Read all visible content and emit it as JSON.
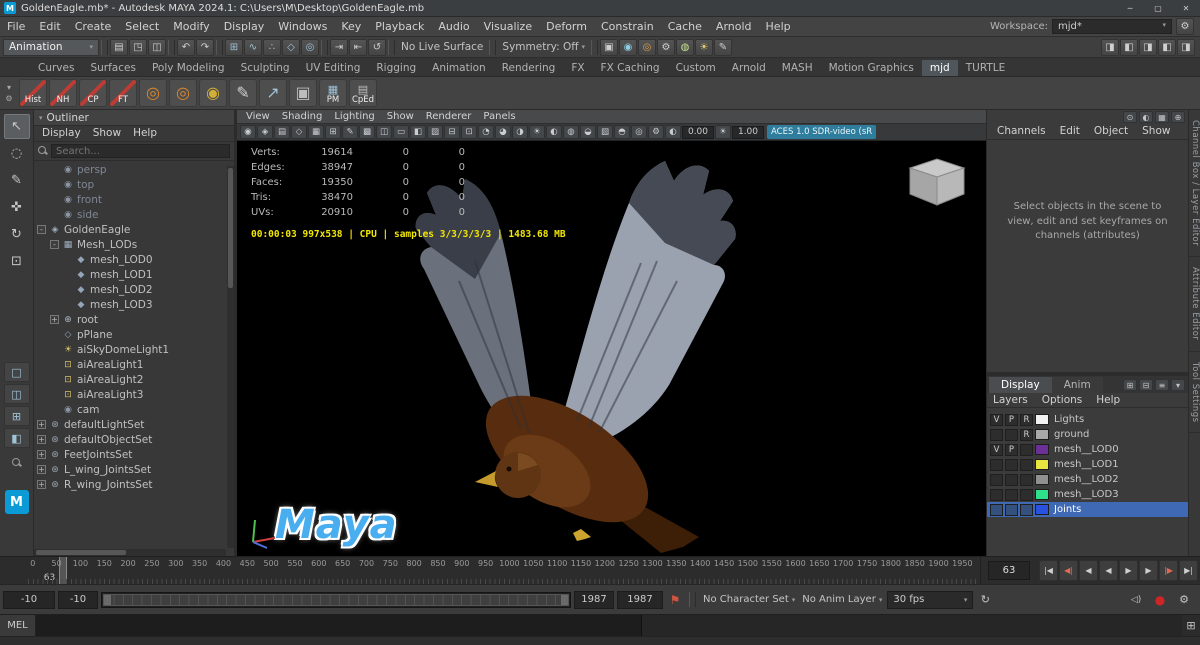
{
  "titlebar": {
    "title": "GoldenEagle.mb* - Autodesk MAYA 2024.1: C:\\Users\\M\\Desktop\\GoldenEagle.mb",
    "window_controls": [
      {
        "name": "minimize-button",
        "glyph": "─"
      },
      {
        "name": "maximize-button",
        "glyph": "▢"
      },
      {
        "name": "close-button",
        "glyph": "✕"
      }
    ]
  },
  "menubar": {
    "items": [
      "File",
      "Edit",
      "Create",
      "Select",
      "Modify",
      "Display",
      "Windows",
      "Key",
      "Playback",
      "Audio",
      "Visualize",
      "Deform",
      "Constrain",
      "Cache",
      "Arnold",
      "Help"
    ],
    "workspace_label": "Workspace:",
    "workspace_value": "mjd*"
  },
  "statusline": {
    "mode_selector": "Animation",
    "groups": [
      {
        "name": "file",
        "icons": [
          {
            "n": "new-scene-icon",
            "g": "▤"
          },
          {
            "n": "open-scene-icon",
            "g": "◳"
          },
          {
            "n": "save-scene-icon",
            "g": "◫"
          }
        ]
      },
      {
        "name": "undo",
        "icons": [
          {
            "n": "undo-icon",
            "g": "↶"
          },
          {
            "n": "redo-icon",
            "g": "↷"
          }
        ]
      },
      {
        "name": "snap",
        "icons": [
          {
            "n": "snap-grid-icon",
            "g": "⊞",
            "c": "#9fc3d8"
          },
          {
            "n": "snap-curve-icon",
            "g": "∿",
            "c": "#9fc3d8"
          },
          {
            "n": "snap-point-icon",
            "g": "∴",
            "c": "#9fc3d8"
          },
          {
            "n": "snap-plane-icon",
            "g": "◇",
            "c": "#9fc3d8"
          },
          {
            "n": "snap-center-icon",
            "g": "◎",
            "c": "#9fc3d8"
          }
        ]
      },
      {
        "name": "history",
        "icons": [
          {
            "n": "input-connections-icon",
            "g": "⇥"
          },
          {
            "n": "output-connections-icon",
            "g": "⇤"
          },
          {
            "n": "construction-history-icon",
            "g": "↺"
          }
        ]
      }
    ],
    "no_live_surface": "No Live Surface",
    "symmetry": "Symmetry: Off",
    "center_icons": [
      {
        "n": "render-view-icon",
        "g": "▣"
      },
      {
        "n": "render-current-frame-icon",
        "g": "◉",
        "c": "#8fd0e8"
      },
      {
        "n": "ipr-render-icon",
        "g": "◎",
        "c": "#e0a050"
      },
      {
        "n": "render-settings-icon",
        "g": "⚙"
      },
      {
        "n": "hypershade-icon",
        "g": "◍",
        "c": "#c8e090"
      },
      {
        "n": "light-editor-icon",
        "g": "☀",
        "c": "#e8d070"
      },
      {
        "n": "paint-effects-icon",
        "g": "✎"
      }
    ],
    "right_icons": [
      {
        "n": "toggle-modeling-toolkit-icon",
        "g": "◨"
      },
      {
        "n": "toggle-hypershade-panel-icon",
        "g": "◧"
      },
      {
        "n": "toggle-attribute-editor-icon",
        "g": "◨"
      },
      {
        "n": "toggle-tool-settings-icon",
        "g": "◧"
      },
      {
        "n": "toggle-channel-box-icon",
        "g": "◨"
      }
    ]
  },
  "shelf": {
    "tabs": [
      "Curves",
      "Surfaces",
      "Poly Modeling",
      "Sculpting",
      "UV Editing",
      "Rigging",
      "Animation",
      "Rendering",
      "FX",
      "FX Caching",
      "Custom",
      "Arnold",
      "MASH",
      "Motion Graphics",
      "mjd",
      "TURTLE"
    ],
    "active_tab": "mjd",
    "mini_icons": [
      {
        "n": "shelf-menu-icon",
        "g": "▾"
      },
      {
        "n": "shelf-gear-icon",
        "g": "⚙"
      }
    ],
    "buttons": [
      {
        "type": "text",
        "label": "Hist",
        "name": "shelf-hist-button"
      },
      {
        "type": "text",
        "label": "NH",
        "name": "shelf-nh-button"
      },
      {
        "type": "text",
        "label": "CP",
        "name": "shelf-cp-button"
      },
      {
        "type": "text",
        "label": "FT",
        "name": "shelf-ft-button"
      },
      {
        "type": "icon",
        "glyph": "◎",
        "color": "#e08a2d",
        "name": "shelf-torus1-button"
      },
      {
        "type": "icon",
        "glyph": "◎",
        "color": "#e08a2d",
        "name": "shelf-torus2-button"
      },
      {
        "type": "icon",
        "glyph": "◉",
        "color": "#d4af37",
        "name": "shelf-rings-button"
      },
      {
        "type": "icon",
        "glyph": "✎",
        "color": "#cfcfcf",
        "name": "shelf-pencil-button"
      },
      {
        "type": "icon",
        "glyph": "↗",
        "color": "#9fc3d8",
        "name": "shelf-arrow-button"
      },
      {
        "type": "icon",
        "glyph": "▣",
        "color": "#bdbdbd",
        "name": "shelf-clipboard-button"
      },
      {
        "type": "labeled",
        "label": "PM",
        "glyph": "▦",
        "color": "#9fc3d8",
        "name": "shelf-pm-button"
      },
      {
        "type": "labeled",
        "label": "CpEd",
        "glyph": "▤",
        "color": "#bdbdbd",
        "name": "shelf-cped-button"
      }
    ]
  },
  "toolbox": {
    "tools": [
      {
        "name": "select-tool",
        "glyph": "↖",
        "active": true
      },
      {
        "name": "lasso-select-tool",
        "glyph": "◌"
      },
      {
        "name": "paint-select-tool",
        "glyph": "✎"
      },
      {
        "name": "move-tool",
        "glyph": "✜"
      },
      {
        "name": "rotate-tool",
        "glyph": "↻"
      },
      {
        "name": "scale-tool",
        "glyph": "⊡"
      }
    ],
    "layouts": [
      {
        "name": "layout-single-pane-button",
        "glyph": "□"
      },
      {
        "name": "layout-two-pane-button",
        "glyph": "◫"
      },
      {
        "name": "layout-four-pane-button",
        "glyph": "⊞"
      },
      {
        "name": "layout-outliner-persp-button",
        "glyph": "◧"
      }
    ],
    "logo_text": "M"
  },
  "outliner": {
    "title": "Outliner",
    "menus": [
      "Display",
      "Show",
      "Help"
    ],
    "search_placeholder": "Search...",
    "icon_styles": {
      "camera": {
        "g": "◉",
        "c": "#8b97a6"
      },
      "transform": {
        "g": "◈",
        "c": "#9fb0c0"
      },
      "group": {
        "g": "▦",
        "c": "#9fb0c0"
      },
      "mesh": {
        "g": "◆",
        "c": "#93a5b8"
      },
      "joint": {
        "g": "⊕",
        "c": "#aab6c4"
      },
      "plane": {
        "g": "◇",
        "c": "#93a5b8"
      },
      "skylight": {
        "g": "☀",
        "c": "#d8c36a"
      },
      "arealight": {
        "g": "⊡",
        "c": "#d8c36a"
      },
      "set": {
        "g": "⊛",
        "c": "#9aa5af"
      }
    },
    "items": [
      {
        "label": "persp",
        "icon": "camera",
        "depth": 1,
        "dim": true
      },
      {
        "label": "top",
        "icon": "camera",
        "depth": 1,
        "dim": true
      },
      {
        "label": "front",
        "icon": "camera",
        "depth": 1,
        "dim": true
      },
      {
        "label": "side",
        "icon": "camera",
        "depth": 1,
        "dim": true
      },
      {
        "label": "GoldenEagle",
        "icon": "transform",
        "depth": 0,
        "exp": "-"
      },
      {
        "label": "Mesh_LODs",
        "icon": "group",
        "depth": 1,
        "exp": "-"
      },
      {
        "label": "mesh_LOD0",
        "icon": "mesh",
        "depth": 2
      },
      {
        "label": "mesh_LOD1",
        "icon": "mesh",
        "depth": 2
      },
      {
        "label": "mesh_LOD2",
        "icon": "mesh",
        "depth": 2
      },
      {
        "label": "mesh_LOD3",
        "icon": "mesh",
        "depth": 2
      },
      {
        "label": "root",
        "icon": "joint",
        "depth": 1,
        "exp": "+"
      },
      {
        "label": "pPlane",
        "icon": "plane",
        "depth": 1
      },
      {
        "label": "aiSkyDomeLight1",
        "icon": "skylight",
        "depth": 1
      },
      {
        "label": "aiAreaLight1",
        "icon": "arealight",
        "depth": 1
      },
      {
        "label": "aiAreaLight2",
        "icon": "arealight",
        "depth": 1
      },
      {
        "label": "aiAreaLight3",
        "icon": "arealight",
        "depth": 1
      },
      {
        "label": "cam",
        "icon": "camera",
        "depth": 1
      },
      {
        "label": "defaultLightSet",
        "icon": "set",
        "depth": 0,
        "exp": "+"
      },
      {
        "label": "defaultObjectSet",
        "icon": "set",
        "depth": 0,
        "exp": "+"
      },
      {
        "label": "FeetJointsSet",
        "icon": "set",
        "depth": 0,
        "exp": "+"
      },
      {
        "label": "L_wing_JointsSet",
        "icon": "set",
        "depth": 0,
        "exp": "+"
      },
      {
        "label": "R_wing_JointsSet",
        "icon": "set",
        "depth": 0,
        "exp": "+"
      }
    ]
  },
  "viewport": {
    "menus": [
      "View",
      "Shading",
      "Lighting",
      "Show",
      "Renderer",
      "Panels"
    ],
    "toolbar_icons": [
      {
        "n": "select-camera-icon",
        "g": "◉"
      },
      {
        "n": "lock-camera-icon",
        "g": "◈"
      },
      {
        "n": "camera-attributes-icon",
        "g": "▤"
      },
      {
        "n": "bookmarks-icon",
        "g": "◇"
      },
      {
        "n": "image-plane-icon",
        "g": "▦"
      },
      {
        "n": "2d-pan-zoom-icon",
        "g": "⊞"
      },
      {
        "n": "grease-pencil-icon",
        "g": "✎"
      },
      {
        "n": "grid-icon",
        "g": "▩"
      },
      {
        "n": "film-gate-icon",
        "g": "◫"
      },
      {
        "n": "resolution-gate-icon",
        "g": "▭"
      },
      {
        "n": "gate-mask-icon",
        "g": "◧"
      },
      {
        "n": "field-chart-icon",
        "g": "▨"
      },
      {
        "n": "safe-action-icon",
        "g": "⊟"
      },
      {
        "n": "safe-title-icon",
        "g": "⊡"
      },
      {
        "n": "wireframe-icon",
        "g": "◔"
      },
      {
        "n": "shaded-icon",
        "g": "◕"
      },
      {
        "n": "textured-icon",
        "g": "◑"
      },
      {
        "n": "use-all-lights-icon",
        "g": "☀"
      },
      {
        "n": "shadows-icon",
        "g": "◐"
      },
      {
        "n": "screen-space-ao-icon",
        "g": "◍"
      },
      {
        "n": "motion-blur-icon",
        "g": "◒"
      },
      {
        "n": "multisample-icon",
        "g": "▧"
      },
      {
        "n": "xray-icon",
        "g": "◓"
      },
      {
        "n": "isolate-select-icon",
        "g": "◎"
      }
    ],
    "gear_icon": "⚙",
    "exposure_icon": "◐",
    "gamma_icon": "☀",
    "exposure": "0.00",
    "gamma": "1.00",
    "colorspace": "ACES 1.0 SDR-video (sR",
    "hud": {
      "rows": [
        {
          "label": "Verts:",
          "v1": "19614",
          "v2": "0",
          "v3": "0"
        },
        {
          "label": "Edges:",
          "v1": "38947",
          "v2": "0",
          "v3": "0"
        },
        {
          "label": "Faces:",
          "v1": "19350",
          "v2": "0",
          "v3": "0"
        },
        {
          "label": "Tris:",
          "v1": "38470",
          "v2": "0",
          "v3": "0"
        },
        {
          "label": "UVs:",
          "v1": "20910",
          "v2": "0",
          "v3": "0"
        }
      ]
    },
    "render_stats": "00:00:03 997x538 | CPU | samples 3/3/3/3/3 | 1483.68 MB",
    "watermark": "Maya"
  },
  "right_panel": {
    "cb_icons": [
      {
        "n": "channel-pin-icon",
        "g": "⊙"
      },
      {
        "n": "channel-speed-icon",
        "g": "◐"
      },
      {
        "n": "channel-hyper-icon",
        "g": "▦"
      },
      {
        "n": "channel-manip-icon",
        "g": "⊕"
      }
    ],
    "channel_menus": [
      "Channels",
      "Edit",
      "Object",
      "Show"
    ],
    "hint": "Select objects in the scene to view, edit and set keyframes on channels (attributes)",
    "layer_tabs": [
      "Display",
      "Anim"
    ],
    "active_layer_tab": "Display",
    "layer_tab_icons": [
      {
        "n": "add-layer-icon",
        "g": "⊞"
      },
      {
        "n": "add-layer-from-selected-icon",
        "g": "⊟"
      },
      {
        "n": "move-layer-icon",
        "g": "≡"
      },
      {
        "n": "layer-sort-icon",
        "g": "▾"
      }
    ],
    "layer_menus": [
      "Layers",
      "Options",
      "Help"
    ],
    "layers": [
      {
        "v": "V",
        "p": "P",
        "r": "R",
        "swatch": "#f2f2f2",
        "label": "Lights",
        "selected": false
      },
      {
        "v": "",
        "p": "",
        "r": "R",
        "swatch": "#a8a8a8",
        "label": "ground",
        "selected": false
      },
      {
        "v": "V",
        "p": "P",
        "r": "",
        "swatch": "#6a3096",
        "label": "mesh__LOD0",
        "selected": false
      },
      {
        "v": "",
        "p": "",
        "r": "",
        "swatch": "#e8e440",
        "label": "mesh__LOD1",
        "selected": false
      },
      {
        "v": "",
        "p": "",
        "r": "",
        "swatch": "#909090",
        "label": "mesh__LOD2",
        "selected": false
      },
      {
        "v": "",
        "p": "",
        "r": "",
        "swatch": "#2ee08a",
        "label": "mesh__LOD3",
        "selected": false
      },
      {
        "v": "",
        "p": "",
        "r": "",
        "swatch": "#2a52e0",
        "label": "Joints",
        "selected": true
      }
    ]
  },
  "side_tabs": [
    "Channel Box / Layer Editor",
    "Attribute Editor",
    "Tool Settings"
  ],
  "timeline": {
    "ticks": [
      0,
      50,
      100,
      150,
      200,
      250,
      300,
      350,
      400,
      450,
      500,
      550,
      600,
      650,
      700,
      750,
      800,
      850,
      900,
      950,
      1000,
      1050,
      1100,
      1150,
      1200,
      1250,
      1300,
      1350,
      1400,
      1450,
      1500,
      1550,
      1600,
      1650,
      1700,
      1750,
      1800,
      1850,
      1900,
      1950
    ],
    "range_start": -10,
    "range_end": 1987,
    "current_frame": "63",
    "playback_buttons": [
      {
        "n": "go-to-start-button",
        "g": "|◀"
      },
      {
        "n": "step-back-key-button",
        "g": "◀|",
        "red": true
      },
      {
        "n": "step-back-frame-button",
        "g": "◀"
      },
      {
        "n": "play-backwards-button",
        "g": "◀"
      },
      {
        "n": "play-forwards-button",
        "g": "▶"
      },
      {
        "n": "step-forward-frame-button",
        "g": "▶"
      },
      {
        "n": "step-forward-key-button",
        "g": "|▶",
        "red": true
      },
      {
        "n": "go-to-end-button",
        "g": "▶|"
      }
    ]
  },
  "range_bar": {
    "anim_start": "-10",
    "playback_start": "-10",
    "playback_end": "1987",
    "anim_end": "1987",
    "character_set": "No Character Set",
    "anim_layer": "No Anim Layer",
    "fps": "30 fps"
  },
  "command_line": {
    "label": "MEL"
  },
  "icons": {
    "workspace_gear": "⚙",
    "dropdown_arrow": "▾",
    "bookmark_flag": "⚑",
    "loop": "↻",
    "volume": "◁)",
    "autokey": "●",
    "prefs_gear": "⚙",
    "script_editor": "⊞"
  }
}
